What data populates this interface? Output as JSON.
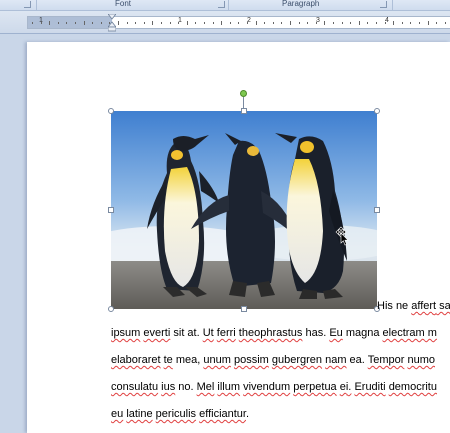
{
  "ribbon": {
    "groups": [
      {
        "label": "Font"
      },
      {
        "label": "Paragraph"
      }
    ]
  },
  "ruler": {
    "numbers": [
      "1",
      "1",
      "2",
      "3",
      "4"
    ]
  },
  "document": {
    "lines": [
      [
        {
          "t": "His ne ",
          "s": false
        },
        {
          "t": "affert",
          "s": true
        },
        {
          "t": " sa",
          "s": true
        }
      ],
      [
        {
          "t": "ipsum",
          "s": true
        },
        {
          "t": " ",
          "s": false
        },
        {
          "t": "everti",
          "s": true
        },
        {
          "t": " sit at. ",
          "s": false
        },
        {
          "t": "Ut",
          "s": true
        },
        {
          "t": " ",
          "s": false
        },
        {
          "t": "ferri",
          "s": true
        },
        {
          "t": " ",
          "s": false
        },
        {
          "t": "theophrastus",
          "s": true
        },
        {
          "t": " has. ",
          "s": false
        },
        {
          "t": "Eu",
          "s": true
        },
        {
          "t": " magna ",
          "s": false
        },
        {
          "t": "electram",
          "s": true
        },
        {
          "t": " m",
          "s": true
        }
      ],
      [
        {
          "t": "elaboraret",
          "s": true
        },
        {
          "t": " ",
          "s": false
        },
        {
          "t": "te",
          "s": true
        },
        {
          "t": " mea, ",
          "s": false
        },
        {
          "t": "unum",
          "s": true
        },
        {
          "t": " ",
          "s": false
        },
        {
          "t": "possim",
          "s": true
        },
        {
          "t": " ",
          "s": false
        },
        {
          "t": "gubergren",
          "s": true
        },
        {
          "t": " ",
          "s": false
        },
        {
          "t": "nam",
          "s": true
        },
        {
          "t": " ea. ",
          "s": false
        },
        {
          "t": "Tempor",
          "s": true
        },
        {
          "t": " ",
          "s": false
        },
        {
          "t": "numo",
          "s": true
        }
      ],
      [
        {
          "t": "consulatu",
          "s": true
        },
        {
          "t": " ",
          "s": false
        },
        {
          "t": "ius",
          "s": true
        },
        {
          "t": " no. ",
          "s": false
        },
        {
          "t": "Mel",
          "s": true
        },
        {
          "t": " ",
          "s": false
        },
        {
          "t": "illum",
          "s": true
        },
        {
          "t": " ",
          "s": false
        },
        {
          "t": "vivendum",
          "s": true
        },
        {
          "t": " ",
          "s": false
        },
        {
          "t": "perpetua",
          "s": true
        },
        {
          "t": " ",
          "s": false
        },
        {
          "t": "ei.",
          "s": true
        },
        {
          "t": " ",
          "s": false
        },
        {
          "t": "Eruditi",
          "s": true
        },
        {
          "t": " ",
          "s": false
        },
        {
          "t": "democritu",
          "s": true
        }
      ],
      [
        {
          "t": "eu",
          "s": true
        },
        {
          "t": " ",
          "s": false
        },
        {
          "t": "latine",
          "s": true
        },
        {
          "t": " ",
          "s": false
        },
        {
          "t": "periculis",
          "s": true
        },
        {
          "t": " ",
          "s": false
        },
        {
          "t": "efficiantur",
          "s": true
        },
        {
          "t": ".",
          "s": false
        }
      ]
    ]
  },
  "colors": {
    "rotate_handle": "#7ec850",
    "spellcheck": "#e04040",
    "ruler_margin": "#aebed6"
  },
  "icons": {
    "cursor": "move-cursor-icon",
    "rotate": "rotate-handle-icon"
  }
}
